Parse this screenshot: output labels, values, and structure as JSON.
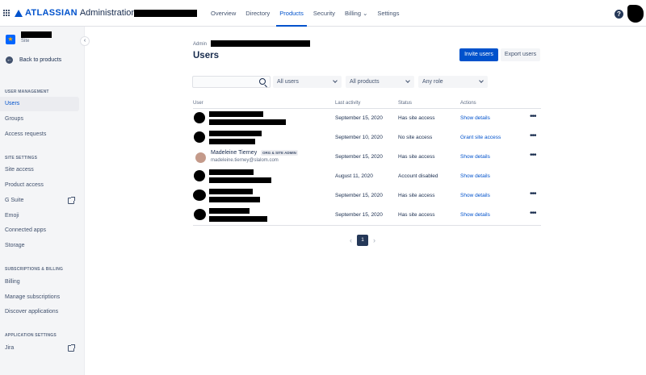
{
  "header": {
    "brand": "ATLASSIAN",
    "product": "Administration",
    "nav": [
      {
        "label": "Overview",
        "active": false
      },
      {
        "label": "Directory",
        "active": false
      },
      {
        "label": "Products",
        "active": true
      },
      {
        "label": "Security",
        "active": false
      },
      {
        "label": "Billing ⌄",
        "active": false
      },
      {
        "label": "Settings",
        "active": false
      }
    ],
    "help": "?"
  },
  "sidebar": {
    "site_label": "Site",
    "back_label": "Back to products",
    "sections": [
      {
        "title": "USER MANAGEMENT",
        "items": [
          "Users",
          "Groups",
          "Access requests"
        ]
      },
      {
        "title": "SITE SETTINGS",
        "items": [
          "Site access",
          "Product access",
          "G Suite",
          "Emoji",
          "Connected apps",
          "Storage"
        ]
      },
      {
        "title": "SUBSCRIPTIONS & BILLING",
        "items": [
          "Billing",
          "Manage subscriptions",
          "Discover applications"
        ]
      },
      {
        "title": "APPLICATION SETTINGS",
        "items": [
          "Jira"
        ]
      }
    ]
  },
  "main": {
    "breadcrumb": "Admin",
    "title": "Users",
    "invite_button": "Invite users",
    "export_button": "Export users",
    "filters": {
      "search_placeholder": "",
      "users": "All users",
      "products": "All products",
      "role": "Any role"
    },
    "columns": [
      "User",
      "Last activity",
      "Status",
      "Actions"
    ],
    "rows": [
      {
        "last_activity": "September 15, 2020",
        "status": "Has site access",
        "action": "Show details",
        "more": true
      },
      {
        "last_activity": "September 10, 2020",
        "status": "No site access",
        "action": "Grant site access",
        "more": true
      },
      {
        "name": "Madeleine Tierney",
        "badge": "ORG & SITE ADMIN",
        "email": "madeleine.tierney@slalom.com",
        "last_activity": "September 15, 2020",
        "status": "Has site access",
        "action": "Show details",
        "more": true
      },
      {
        "last_activity": "August 11, 2020",
        "status": "Account disabled",
        "action": "Show details",
        "more": false
      },
      {
        "last_activity": "September 15, 2020",
        "status": "Has site access",
        "action": "Show details",
        "more": true
      },
      {
        "last_activity": "September 15, 2020",
        "status": "Has site access",
        "action": "Show details",
        "more": true
      }
    ],
    "pagination": {
      "current": "1",
      "prev": "‹",
      "next": "›"
    }
  }
}
